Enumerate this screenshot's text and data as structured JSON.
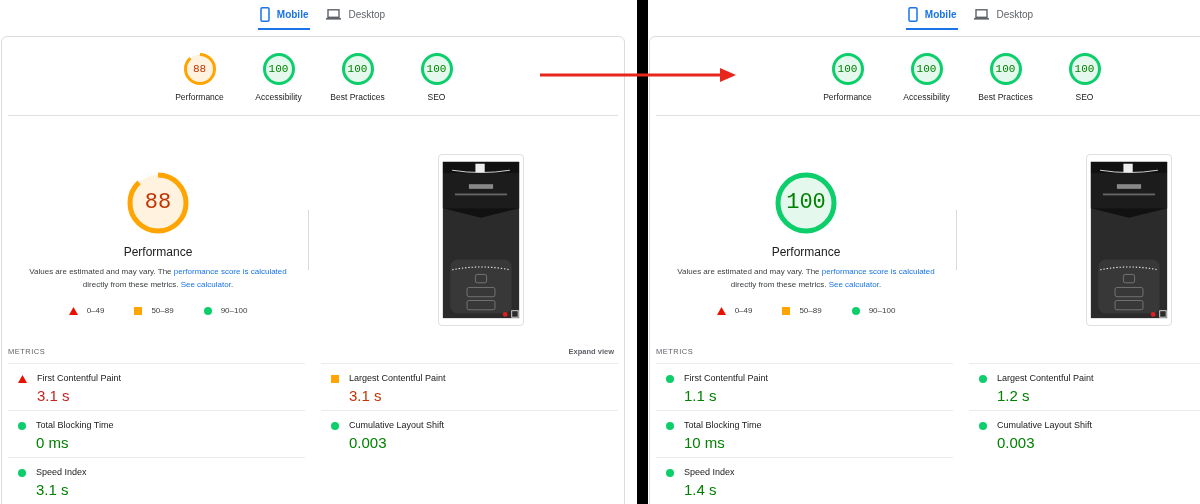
{
  "panels": [
    {
      "tabs": [
        {
          "label": "Mobile",
          "kind": "mobile",
          "selected": true
        },
        {
          "label": "Desktop",
          "kind": "desktop",
          "selected": false
        }
      ],
      "categories": [
        {
          "label": "Performance",
          "score": "88",
          "kind": "average"
        },
        {
          "label": "Accessibility",
          "score": "100",
          "kind": "pass"
        },
        {
          "label": "Best Practices",
          "score": "100",
          "kind": "pass"
        },
        {
          "label": "SEO",
          "score": "100",
          "kind": "pass"
        }
      ],
      "main": {
        "label": "Performance",
        "score": "88",
        "kind": "average"
      },
      "description": {
        "start": "Values are estimated and may vary. The ",
        "score_link": "performance score is calculated",
        "middle": " directly from these metrics. ",
        "calculator_link": "See calculator",
        "end": "."
      },
      "legend": [
        {
          "range": "0–49",
          "kind": "fail"
        },
        {
          "range": "50–89",
          "kind": "average"
        },
        {
          "range": "90–100",
          "kind": "pass"
        }
      ],
      "metrics_heading": "METRICS",
      "expand_link": "Expand view",
      "metrics": [
        {
          "name": "First Contentful Paint",
          "value": "3.1 s",
          "kind": "fail"
        },
        {
          "name": "Largest Contentful Paint",
          "value": "3.1 s",
          "kind": "average"
        },
        {
          "name": "Total Blocking Time",
          "value": "0 ms",
          "kind": "pass"
        },
        {
          "name": "Cumulative Layout Shift",
          "value": "0.003",
          "kind": "pass"
        },
        {
          "name": "Speed Index",
          "value": "3.1 s",
          "kind": "pass"
        }
      ]
    },
    {
      "tabs": [
        {
          "label": "Mobile",
          "kind": "mobile",
          "selected": true
        },
        {
          "label": "Desktop",
          "kind": "desktop",
          "selected": false
        }
      ],
      "categories": [
        {
          "label": "Performance",
          "score": "100",
          "kind": "pass"
        },
        {
          "label": "Accessibility",
          "score": "100",
          "kind": "pass"
        },
        {
          "label": "Best Practices",
          "score": "100",
          "kind": "pass"
        },
        {
          "label": "SEO",
          "score": "100",
          "kind": "pass"
        }
      ],
      "main": {
        "label": "Performance",
        "score": "100",
        "kind": "pass"
      },
      "description": {
        "start": "Values are estimated and may vary. The ",
        "score_link": "performance score is calculated",
        "middle": " directly from these metrics. ",
        "calculator_link": "See calculator",
        "end": "."
      },
      "legend": [
        {
          "range": "0–49",
          "kind": "fail"
        },
        {
          "range": "50–89",
          "kind": "average"
        },
        {
          "range": "90–100",
          "kind": "pass"
        }
      ],
      "metrics_heading": "METRICS",
      "metrics": [
        {
          "name": "First Contentful Paint",
          "value": "1.1 s",
          "kind": "pass"
        },
        {
          "name": "Largest Contentful Paint",
          "value": "1.2 s",
          "kind": "pass"
        },
        {
          "name": "Total Blocking Time",
          "value": "10 ms",
          "kind": "pass"
        },
        {
          "name": "Cumulative Layout Shift",
          "value": "0.003",
          "kind": "pass"
        },
        {
          "name": "Speed Index",
          "value": "1.4 s",
          "kind": "pass"
        }
      ]
    }
  ]
}
